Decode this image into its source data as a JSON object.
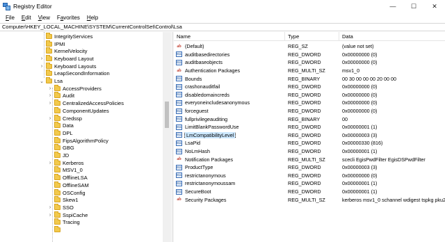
{
  "window": {
    "title": "Registry Editor",
    "minimize": "—",
    "maximize": "☐",
    "close": "✕"
  },
  "menu": [
    {
      "label": "File",
      "mnemonic": "F",
      "rest": "ile"
    },
    {
      "label": "Edit",
      "mnemonic": "E",
      "rest": "dit"
    },
    {
      "label": "View",
      "mnemonic": "V",
      "rest": "iew"
    },
    {
      "label": "Favorites",
      "mnemonic": "a",
      "pre": "F",
      "rest": "vorites"
    },
    {
      "label": "Help",
      "mnemonic": "H",
      "rest": "elp"
    }
  ],
  "address": "Computer\\HKEY_LOCAL_MACHINE\\SYSTEM\\CurrentControlSet\\Control\\Lsa",
  "tree": [
    {
      "label": "IntegrityServices",
      "level": 0,
      "chevron": ""
    },
    {
      "label": "IPMI",
      "level": 0,
      "chevron": ""
    },
    {
      "label": "KernelVelocity",
      "level": 0,
      "chevron": ""
    },
    {
      "label": "Keyboard Layout",
      "level": 0,
      "chevron": "›"
    },
    {
      "label": "Keyboard Layouts",
      "level": 0,
      "chevron": "›"
    },
    {
      "label": "LeapSecondInformation",
      "level": 0,
      "chevron": ""
    },
    {
      "label": "Lsa",
      "level": 0,
      "chevron": "⌄"
    },
    {
      "label": "AccessProviders",
      "level": 1,
      "chevron": "›"
    },
    {
      "label": "Audit",
      "level": 1,
      "chevron": "›"
    },
    {
      "label": "CentralizedAccessPolicies",
      "level": 1,
      "chevron": "›"
    },
    {
      "label": "ComponentUpdates",
      "level": 1,
      "chevron": ""
    },
    {
      "label": "Credssp",
      "level": 1,
      "chevron": "›"
    },
    {
      "label": "Data",
      "level": 1,
      "chevron": ""
    },
    {
      "label": "DPL",
      "level": 1,
      "chevron": ""
    },
    {
      "label": "FipsAlgorithmPolicy",
      "level": 1,
      "chevron": ""
    },
    {
      "label": "GBG",
      "level": 1,
      "chevron": ""
    },
    {
      "label": "JD",
      "level": 1,
      "chevron": ""
    },
    {
      "label": "Kerberos",
      "level": 1,
      "chevron": "›"
    },
    {
      "label": "MSV1_0",
      "level": 1,
      "chevron": ""
    },
    {
      "label": "OfflineLSA",
      "level": 1,
      "chevron": ""
    },
    {
      "label": "OfflineSAM",
      "level": 1,
      "chevron": ""
    },
    {
      "label": "OSConfig",
      "level": 1,
      "chevron": ""
    },
    {
      "label": "Skew1",
      "level": 1,
      "chevron": ""
    },
    {
      "label": "SSO",
      "level": 1,
      "chevron": "›"
    },
    {
      "label": "SspiCache",
      "level": 1,
      "chevron": "›"
    },
    {
      "label": "Tracing",
      "level": 1,
      "chevron": ""
    },
    {
      "label": "",
      "level": 1,
      "chevron": ""
    }
  ],
  "columns": {
    "name": "Name",
    "type": "Type",
    "data": "Data"
  },
  "values": [
    {
      "name": "(Default)",
      "type": "REG_SZ",
      "data": "(value not set)",
      "icon": "string-value-icon",
      "glyph": "ab"
    },
    {
      "name": "auditbasedirectories",
      "type": "REG_DWORD",
      "data": "0x00000000 (0)",
      "icon": "binary-value-icon",
      "glyph": "011"
    },
    {
      "name": "auditbaseobjects",
      "type": "REG_DWORD",
      "data": "0x00000000 (0)",
      "icon": "binary-value-icon",
      "glyph": "011"
    },
    {
      "name": "Authentication Packages",
      "type": "REG_MULTI_SZ",
      "data": "msv1_0",
      "icon": "string-value-icon",
      "glyph": "ab"
    },
    {
      "name": "Bounds",
      "type": "REG_BINARY",
      "data": "00 30 00 00 00 20 00 00",
      "icon": "binary-value-icon",
      "glyph": "011"
    },
    {
      "name": "crashonauditfail",
      "type": "REG_DWORD",
      "data": "0x00000000 (0)",
      "icon": "binary-value-icon",
      "glyph": "011"
    },
    {
      "name": "disabledomaincreds",
      "type": "REG_DWORD",
      "data": "0x00000000 (0)",
      "icon": "binary-value-icon",
      "glyph": "011"
    },
    {
      "name": "everyoneincludesanonymous",
      "type": "REG_DWORD",
      "data": "0x00000000 (0)",
      "icon": "binary-value-icon",
      "glyph": "011"
    },
    {
      "name": "forceguest",
      "type": "REG_DWORD",
      "data": "0x00000000 (0)",
      "icon": "binary-value-icon",
      "glyph": "011"
    },
    {
      "name": "fullprivilegeauditing",
      "type": "REG_BINARY",
      "data": "00",
      "icon": "binary-value-icon",
      "glyph": "011"
    },
    {
      "name": "LimitBlankPasswordUse",
      "type": "REG_DWORD",
      "data": "0x00000001 (1)",
      "icon": "binary-value-icon",
      "glyph": "011"
    },
    {
      "name": "LmCompatibilityLevel",
      "type": "REG_DWORD",
      "data": "0x00000003 (3)",
      "icon": "binary-value-icon",
      "glyph": "011",
      "selected": true
    },
    {
      "name": "LsaPid",
      "type": "REG_DWORD",
      "data": "0x00000330 (816)",
      "icon": "binary-value-icon",
      "glyph": "011"
    },
    {
      "name": "NoLmHash",
      "type": "REG_DWORD",
      "data": "0x00000001 (1)",
      "icon": "binary-value-icon",
      "glyph": "011"
    },
    {
      "name": "Notification Packages",
      "type": "REG_MULTI_SZ",
      "data": "scecli EgisPwdFilter EgisDSPwdFilter",
      "icon": "string-value-icon",
      "glyph": "ab"
    },
    {
      "name": "ProductType",
      "type": "REG_DWORD",
      "data": "0x00000003 (3)",
      "icon": "binary-value-icon",
      "glyph": "011"
    },
    {
      "name": "restrictanonymous",
      "type": "REG_DWORD",
      "data": "0x00000000 (0)",
      "icon": "binary-value-icon",
      "glyph": "011"
    },
    {
      "name": "restrictanonymoussam",
      "type": "REG_DWORD",
      "data": "0x00000001 (1)",
      "icon": "binary-value-icon",
      "glyph": "011"
    },
    {
      "name": "SecureBoot",
      "type": "REG_DWORD",
      "data": "0x00000001 (1)",
      "icon": "binary-value-icon",
      "glyph": "011"
    },
    {
      "name": "Security Packages",
      "type": "REG_MULTI_SZ",
      "data": "kerberos msv1_0 schannel wdigest tspkg pku2u",
      "icon": "string-value-icon",
      "glyph": "ab"
    }
  ]
}
